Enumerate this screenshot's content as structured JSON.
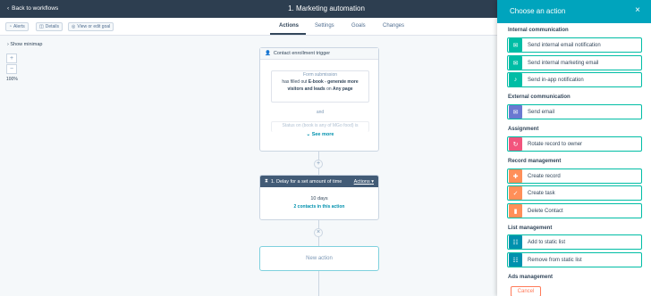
{
  "header": {
    "back_label": "Back to workflows",
    "title": "1. Marketing automation"
  },
  "toolbar": {
    "alerts": "Alerts",
    "details": "Details",
    "goal": "View or edit goal"
  },
  "tabs": [
    "Actions",
    "Settings",
    "Goals",
    "Changes"
  ],
  "canvas": {
    "minimap": "Show minimap",
    "zoom_in": "+",
    "zoom_out": "−",
    "zoom_level": "100%"
  },
  "trigger": {
    "title": "Contact enrollment trigger",
    "form_label": "Form submission",
    "line1_prefix": "has filled out",
    "line1_bold": "E-book - generate more",
    "line2_bold": "visitors and leads",
    "line2_mid": "on",
    "line2_end": "Any page",
    "and": "and",
    "partial": "Status on (book is any of MGo food) is",
    "see_more": "See more"
  },
  "delay": {
    "title": "1. Delay for a set amount of time",
    "actions": "Actions",
    "duration": "10 days",
    "contacts": "2 contacts in this action"
  },
  "connector_icon": "×",
  "add_icon": "+",
  "new_action": "New action",
  "panel": {
    "title": "Choose an action",
    "close": "×",
    "sections": {
      "internal": "Internal communication",
      "external": "External communication",
      "assignment": "Assignment",
      "record": "Record management",
      "list": "List management",
      "ads": "Ads management"
    },
    "items": [
      {
        "label": "Send internal email notification",
        "icon": "mail-icon",
        "color": "#00bda5"
      },
      {
        "label": "Send internal marketing email",
        "icon": "mail-icon",
        "color": "#00bda5"
      },
      {
        "label": "Send in-app notification",
        "icon": "bell-icon",
        "color": "#00bda5"
      },
      {
        "label": "Send email",
        "icon": "mail-icon",
        "color": "#6a78d1"
      },
      {
        "label": "Rotate record to owner",
        "icon": "rotate-icon",
        "color": "#f2547d"
      },
      {
        "label": "Create record",
        "icon": "record-icon",
        "color": "#ff8f59"
      },
      {
        "label": "Create task",
        "icon": "task-icon",
        "color": "#ff8f59"
      },
      {
        "label": "Delete Contact",
        "icon": "delete-icon",
        "color": "#ff8f59"
      },
      {
        "label": "Add to static list",
        "icon": "list-icon",
        "color": "#0091ae"
      },
      {
        "label": "Remove from static list",
        "icon": "list-icon",
        "color": "#0091ae"
      }
    ],
    "cancel": "Cancel"
  }
}
